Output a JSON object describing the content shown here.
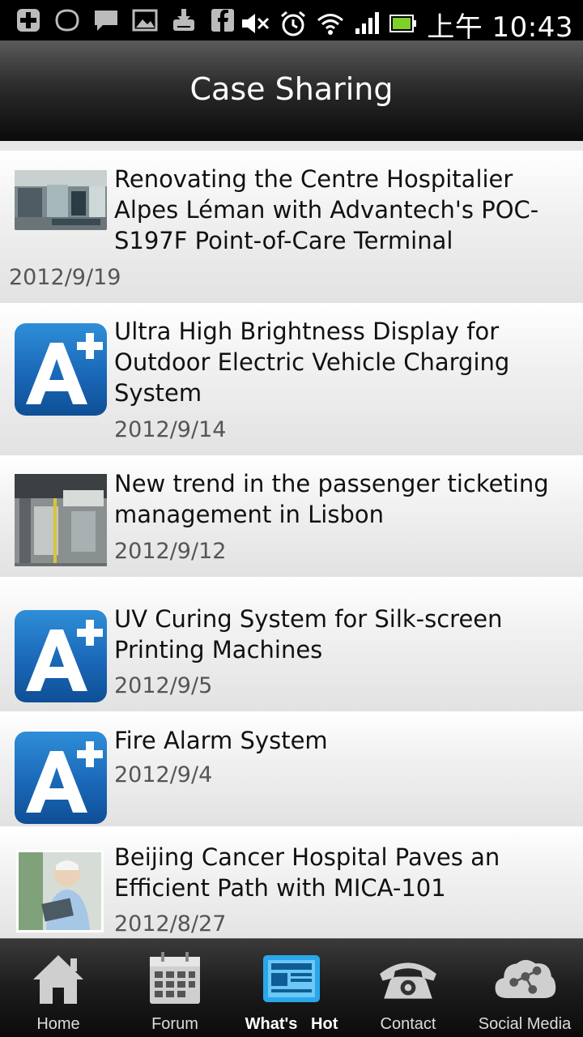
{
  "status_bar": {
    "time": "上午 10:43",
    "icons": [
      "add-icon",
      "chat-bubble-icon",
      "message-icon",
      "image-icon",
      "download-icon",
      "facebook-icon",
      "mute-icon",
      "alarm-icon",
      "wifi-icon",
      "signal-icon",
      "battery-icon"
    ]
  },
  "header": {
    "title": "Case Sharing"
  },
  "articles": [
    {
      "title": "Renovating the Centre Hospitalier Alpes Léman with Advantech's POC-S197F Point-of-Care Terminal",
      "date": "2012/9/19",
      "thumbnail": "photo"
    },
    {
      "title": "Ultra High Brightness Display for Outdoor Electric Vehicle Charging System",
      "date": "2012/9/14",
      "thumbnail": "aplus-logo"
    },
    {
      "title": "New trend in the passenger ticketing management in Lisbon",
      "date": "2012/9/12",
      "thumbnail": "photo"
    },
    {
      "title": "UV Curing System for Silk-screen Printing Machines",
      "date": "2012/9/5",
      "thumbnail": "aplus-logo"
    },
    {
      "title": "Fire Alarm System",
      "date": "2012/9/4",
      "thumbnail": "aplus-logo"
    },
    {
      "title": "Beijing Cancer Hospital Paves an Efficient Path with MICA-101",
      "date": "2012/8/27",
      "thumbnail": "photo"
    }
  ],
  "tabs": [
    {
      "label": "Home",
      "icon": "home-icon",
      "active": false
    },
    {
      "label": "Forum",
      "icon": "forum-icon",
      "active": false
    },
    {
      "label": "What's   Hot",
      "icon": "news-icon",
      "active": true
    },
    {
      "label": "Contact",
      "icon": "phone-icon",
      "active": false
    },
    {
      "label": "Social Media",
      "icon": "cloud-network-icon",
      "active": false
    }
  ]
}
